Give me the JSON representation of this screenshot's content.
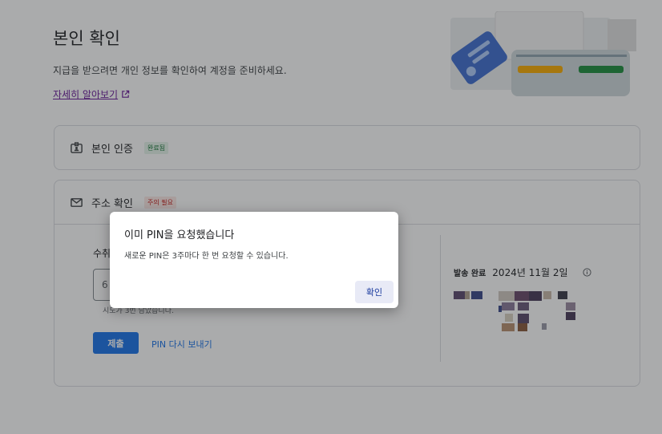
{
  "page": {
    "title": "본인 확인",
    "subtitle": "지급을 받으려면 개인 정보를 확인하여 계정을 준비하세요.",
    "learn_more": "자세히 알아보기"
  },
  "identity_card": {
    "title": "본인 인증",
    "badge": "완료됨"
  },
  "address_card": {
    "title": "주소 확인",
    "badge": "주의 필요",
    "recipient_label": "수취",
    "pin_input_value": "6",
    "remaining_text": "시도가 3번 남았습니다.",
    "submit_label": "제출",
    "resend_label": "PIN 다시 보내기",
    "sent_label": "발송 완료",
    "sent_date": "2024년 11월 2일"
  },
  "dialog": {
    "title": "이미 PIN을 요청했습니다",
    "body": "새로운 PIN은 3주마다 한 번 요청할 수 있습니다.",
    "confirm_label": "확인"
  },
  "icons": {
    "external_link": "external-link-icon",
    "identity": "id-badge-icon",
    "mail": "mail-icon",
    "info": "info-icon"
  },
  "colors": {
    "primary": "#1a73e8",
    "success": "#137333",
    "warning": "#c5221f",
    "scrim": "rgba(32,33,36,0.38)"
  }
}
